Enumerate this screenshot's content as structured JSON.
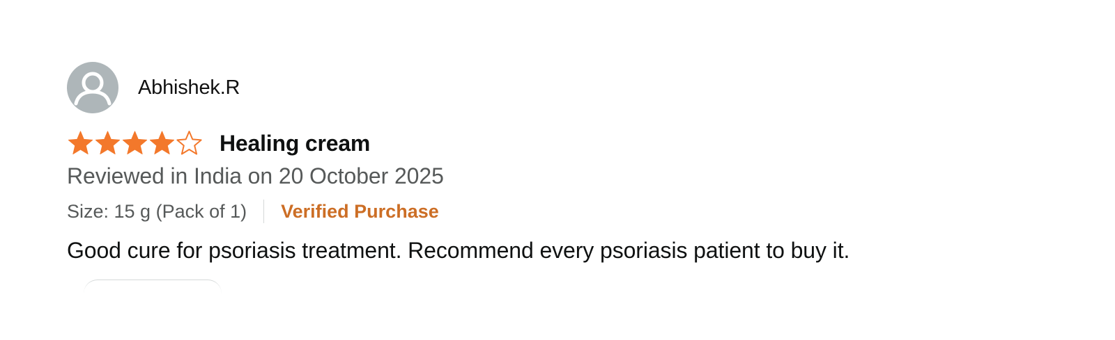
{
  "review": {
    "reviewer_name": "Abhishek.R",
    "avatar_icon": "user-avatar-icon",
    "rating": 4,
    "rating_max": 5,
    "star_color": "#f3782b",
    "title": "Healing cream",
    "review_date": "Reviewed in India on 20 October 2025",
    "variant": "Size: 15 g (Pack of 1)",
    "verified_label": "Verified Purchase",
    "verified_color": "#c45500",
    "body": "Good cure for psoriasis treatment. Recommend every psoriasis patient to buy it."
  }
}
